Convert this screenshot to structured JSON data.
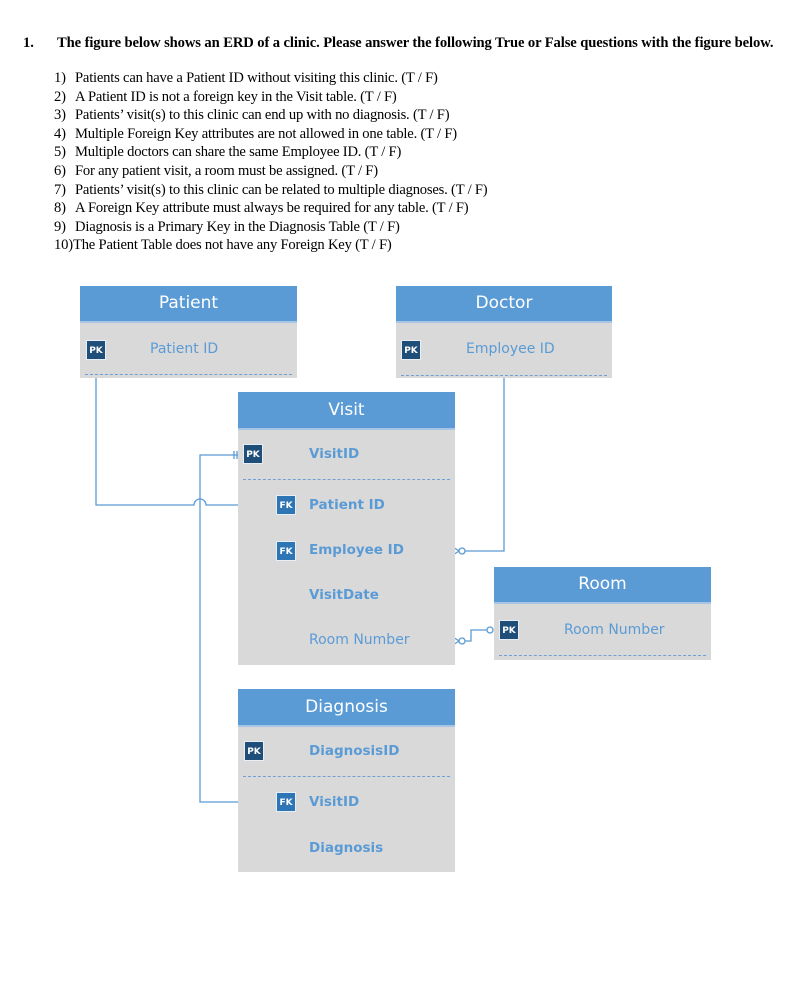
{
  "question": {
    "number": "1.",
    "prompt": "The figure below shows an ERD of a clinic. Please answer the following True or False questions with the figure below.",
    "items": [
      {
        "n": "1)",
        "text": "Patients can have a Patient ID without visiting this clinic. (T / F)"
      },
      {
        "n": "2)",
        "text": "A Patient ID is not a foreign key in the Visit table. (T / F)"
      },
      {
        "n": "3)",
        "text": "Patients’ visit(s) to this clinic can end up with no diagnosis. (T / F)"
      },
      {
        "n": "4)",
        "text": "Multiple Foreign Key attributes are not allowed in one table. (T / F)"
      },
      {
        "n": "5)",
        "text": "Multiple doctors can share the same Employee ID. (T / F)"
      },
      {
        "n": "6)",
        "text": "For any patient visit, a room must be assigned. (T / F)"
      },
      {
        "n": "7)",
        "text": "Patients’ visit(s) to this clinic can be related to multiple diagnoses. (T / F)"
      },
      {
        "n": "8)",
        "text": "A Foreign Key attribute must always be required for any table. (T / F)"
      },
      {
        "n": "9)",
        "text": "Diagnosis is a Primary Key in the Diagnosis Table (T / F)"
      },
      {
        "n": "10)",
        "text": "The Patient Table does not have any Foreign Key (T / F)"
      }
    ]
  },
  "erd": {
    "colors": {
      "header": "#5b9bd5",
      "body": "#d9d9d9",
      "pk_badge": "#1f4e79",
      "fk_badge": "#2e75b6",
      "attr_text": "#5b9bd5",
      "line": "#5b9bd5"
    },
    "pk_label": "PK",
    "fk_label": "FK",
    "patient": {
      "title": "Patient",
      "attrs": [
        "Patient ID"
      ]
    },
    "doctor": {
      "title": "Doctor",
      "attrs": [
        "Employee ID"
      ]
    },
    "visit": {
      "title": "Visit",
      "attrs": [
        "VisitID",
        "Patient ID",
        "Employee ID",
        "VisitDate",
        "Room Number"
      ]
    },
    "room": {
      "title": "Room",
      "attrs": [
        "Room Number"
      ]
    },
    "diagnosis": {
      "title": "Diagnosis",
      "attrs": [
        "DiagnosisID",
        "VisitID",
        "Diagnosis"
      ]
    },
    "relationships": [
      {
        "from": "Patient.Patient ID",
        "to": "Visit.Patient ID",
        "from_card": "one-and-only-one",
        "to_card": "zero-or-many"
      },
      {
        "from": "Doctor.Employee ID",
        "to": "Visit.Employee ID",
        "from_card": "one-and-only-one",
        "to_card": "zero-or-many"
      },
      {
        "from": "Room.Room Number",
        "to": "Visit.Room Number",
        "from_card": "zero-or-one",
        "to_card": "zero-or-many"
      },
      {
        "from": "Visit.VisitID",
        "to": "Diagnosis.VisitID",
        "from_card": "one-and-only-one",
        "to_card": "zero-or-many"
      }
    ]
  }
}
